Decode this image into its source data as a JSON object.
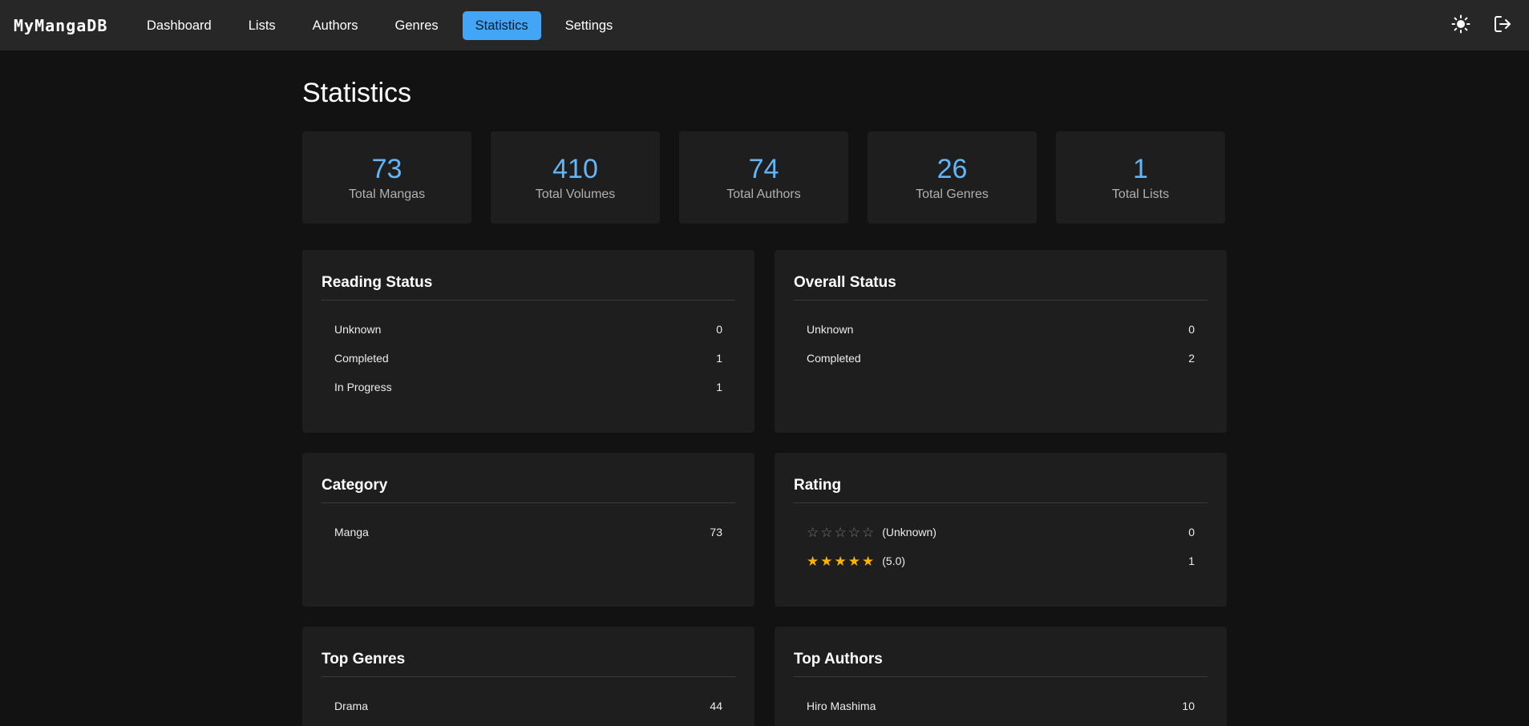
{
  "app": {
    "brand": "MyMangaDB"
  },
  "nav": {
    "items": [
      {
        "label": "Dashboard",
        "active": false
      },
      {
        "label": "Lists",
        "active": false
      },
      {
        "label": "Authors",
        "active": false
      },
      {
        "label": "Genres",
        "active": false
      },
      {
        "label": "Statistics",
        "active": true
      },
      {
        "label": "Settings",
        "active": false
      }
    ],
    "icons": [
      "sun-icon",
      "logout-icon"
    ]
  },
  "page": {
    "title": "Statistics"
  },
  "summary": [
    {
      "value": "73",
      "label": "Total Mangas"
    },
    {
      "value": "410",
      "label": "Total Volumes"
    },
    {
      "value": "74",
      "label": "Total Authors"
    },
    {
      "value": "26",
      "label": "Total Genres"
    },
    {
      "value": "1",
      "label": "Total Lists"
    }
  ],
  "reading_status": {
    "title": "Reading Status",
    "rows": [
      {
        "label": "Unknown",
        "value": "0"
      },
      {
        "label": "Completed",
        "value": "1"
      },
      {
        "label": "In Progress",
        "value": "1"
      }
    ]
  },
  "overall_status": {
    "title": "Overall Status",
    "rows": [
      {
        "label": "Unknown",
        "value": "0"
      },
      {
        "label": "Completed",
        "value": "2"
      }
    ]
  },
  "category": {
    "title": "Category",
    "rows": [
      {
        "label": "Manga",
        "value": "73"
      }
    ]
  },
  "rating": {
    "title": "Rating",
    "rows": [
      {
        "stars": 0,
        "label": "(Unknown)",
        "value": "0"
      },
      {
        "stars": 5,
        "label": "(5.0)",
        "value": "1"
      }
    ]
  },
  "top_genres": {
    "title": "Top Genres",
    "rows": [
      {
        "label": "Drama",
        "value": "44"
      }
    ]
  },
  "top_authors": {
    "title": "Top Authors",
    "rows": [
      {
        "label": "Hiro Mashima",
        "value": "10"
      }
    ]
  },
  "colors": {
    "accent": "#42a5f5",
    "number": "#64b5f6",
    "star": "#ffb300",
    "background": "#121212",
    "surface": "#1e1e1e"
  }
}
